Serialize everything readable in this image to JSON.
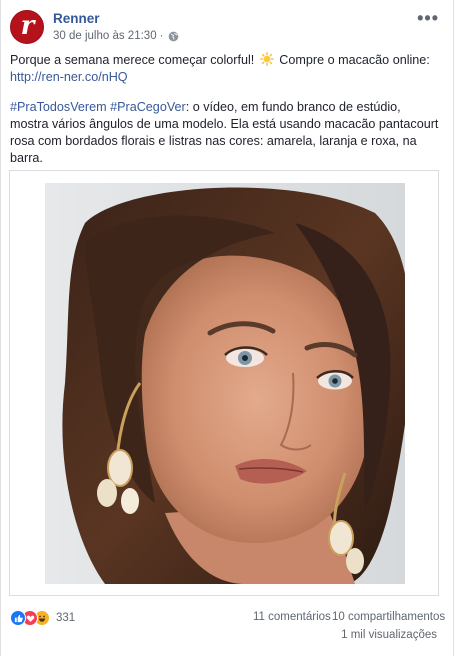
{
  "post": {
    "page_name": "Renner",
    "avatar_letter": "r",
    "timestamp": "30 de julho às 21:30",
    "separator": "·",
    "more_label": "•••",
    "text_line1": "Porque a semana merece começar colorful!",
    "text_line1b": "Compre o macacão online:",
    "link": "http://ren-ner.co/nHQ",
    "hashtag1": "#PraTodosVerem",
    "hashtag2": "#PraCegoVer",
    "description": ": o vídeo, em fundo branco de estúdio, mostra vários ângulos de uma modelo. Ela está usando macacão pantacourt rosa com bordados florais e listras nas cores: amarela, laranja e roxa, na barra."
  },
  "footer": {
    "reaction_count": "331",
    "comments": "11 comentários",
    "shares": "10 compartilhamentos",
    "views": "1 mil visualizações"
  },
  "colors": {
    "brand": "#b5121b",
    "link": "#385898",
    "like": "#1877f2",
    "love": "#f33e58",
    "haha": "#f7b125"
  }
}
